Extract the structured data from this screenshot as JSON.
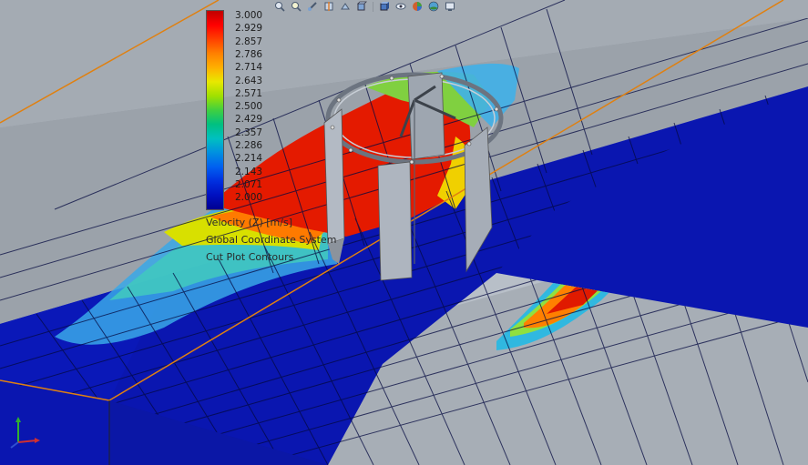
{
  "legend": {
    "ticks": [
      "3.000",
      "2.929",
      "2.857",
      "2.786",
      "2.714",
      "2.643",
      "2.571",
      "2.500",
      "2.429",
      "2.357",
      "2.286",
      "2.214",
      "2.143",
      "2.071",
      "2.000"
    ],
    "colors": [
      "#c00000",
      "#ff0000",
      "#ff4000",
      "#ff8000",
      "#ffb000",
      "#e8e800",
      "#a0e000",
      "#40d040",
      "#00c080",
      "#00c0c0",
      "#0090e0",
      "#0060f0",
      "#0030e0",
      "#0010c0",
      "#000090"
    ],
    "info": {
      "quantity": "Velocity (Z) [m/s]",
      "coordinate_system": "Global Coordinate System",
      "plot_type": "Cut Plot Contours",
      "extra": ""
    }
  },
  "toolbar": {
    "icons": [
      "zoom-to-fit-icon",
      "zoom-to-area-icon",
      "previous-view-icon",
      "section-view-icon",
      "dynamic-annotation-icon",
      "view-orientation-icon",
      "display-style-icon",
      "hide-show-items-icon",
      "edit-appearance-icon",
      "apply-scene-icon",
      "view-settings-icon"
    ]
  },
  "colors": {
    "channel_side": "#9aa0a8",
    "channel_top": "#a9b0b8",
    "plot_blue": "#0a1aa8",
    "grid": "#000040",
    "edge_line": "#e08010",
    "turbine": "#a0aab8"
  }
}
